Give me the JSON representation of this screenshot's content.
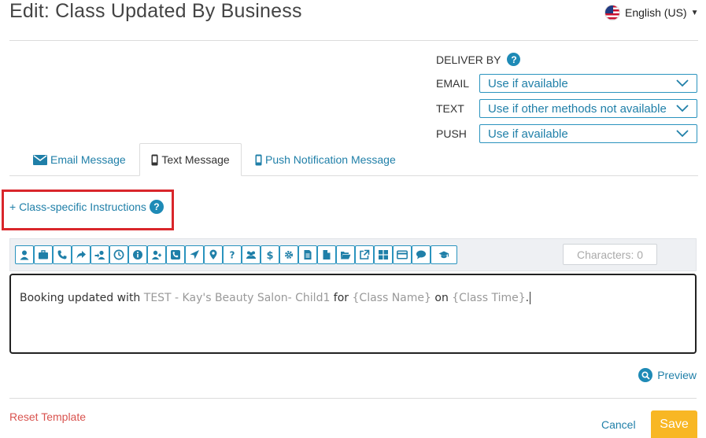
{
  "header": {
    "title": "Edit: Class Updated By Business",
    "language": "English (US)",
    "language_icon": "us-flag-icon"
  },
  "deliver_by": {
    "title": "DELIVER BY",
    "rows": [
      {
        "label": "EMAIL",
        "value": "Use if available"
      },
      {
        "label": "TEXT",
        "value": "Use if other methods not available"
      },
      {
        "label": "PUSH",
        "value": "Use if available"
      }
    ]
  },
  "tabs": [
    {
      "label": "Email Message",
      "icon": "envelope-icon",
      "active": false
    },
    {
      "label": "Text Message",
      "icon": "mobile-phone-icon",
      "active": true
    },
    {
      "label": "Push Notification Message",
      "icon": "mobile-phone-icon",
      "active": false
    }
  ],
  "instructions_link": "+ Class-specific Instructions",
  "toolbar": {
    "icons": [
      "user-icon",
      "briefcase-icon",
      "phone-icon",
      "share-icon",
      "transfer-user-icon",
      "clock-icon",
      "info-icon",
      "add-user-icon",
      "phone-square-icon",
      "location-arrow-icon",
      "map-marker-icon",
      "question-icon",
      "users-icon",
      "dollar-icon",
      "gear-icon",
      "file-text-icon",
      "file-icon",
      "folder-open-icon",
      "external-link-icon",
      "grid-icon",
      "credit-card-icon",
      "comment-icon",
      "graduation-cap-icon"
    ],
    "characters": "Characters: 0"
  },
  "message": {
    "parts": [
      {
        "text": "Booking updated with ",
        "var": false
      },
      {
        "text": "TEST - Kay's Beauty Salon- Child1",
        "var": true
      },
      {
        "text": " for ",
        "var": false
      },
      {
        "text": "{Class Name}",
        "var": true
      },
      {
        "text": " on ",
        "var": false
      },
      {
        "text": "{Class Time}",
        "var": true
      },
      {
        "text": ".",
        "var": false
      }
    ]
  },
  "preview_label": "Preview",
  "footer": {
    "reset_label": "Reset Template",
    "cancel_label": "Cancel",
    "save_label": "Save"
  },
  "colors": {
    "accent": "#1f7fa8",
    "save": "#f8b724",
    "highlight": "#d9262b",
    "reset": "#d9534f"
  }
}
